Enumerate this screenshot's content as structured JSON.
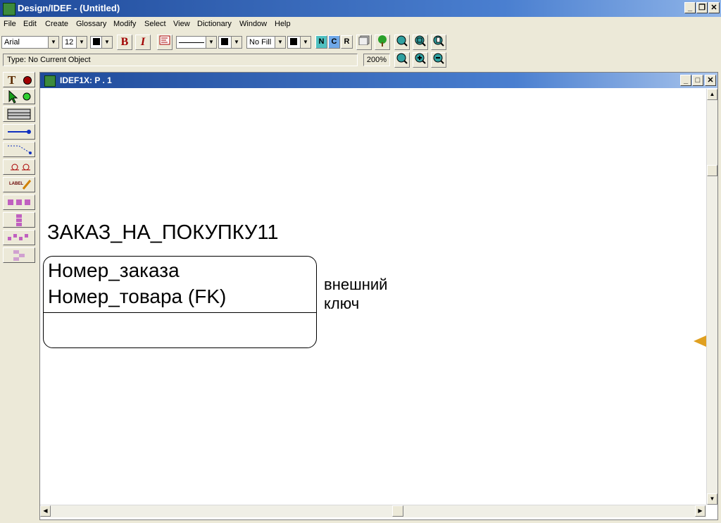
{
  "app": {
    "title": "Design/IDEF - (Untitled)"
  },
  "menu": [
    "File",
    "Edit",
    "Create",
    "Glossary",
    "Modify",
    "Select",
    "View",
    "Dictionary",
    "Window",
    "Help"
  ],
  "toolbar": {
    "font_name": "Arial",
    "font_size": "12",
    "fill": "No Fill",
    "bold_label": "B",
    "italic_label": "I",
    "n_label": "N",
    "c_label": "C",
    "r_label": "R"
  },
  "status": {
    "type_text": "Type: No Current Object",
    "zoom": "200%"
  },
  "palette": {
    "text_label": "T",
    "label_tool": "LABEL"
  },
  "child_window": {
    "title": "IDEF1X:   P . 1"
  },
  "diagram": {
    "entity_name": "ЗАКАЗ_НА_ПОКУПКУ11",
    "attributes": [
      "Номер_заказа",
      "Номер_товара (FK)"
    ],
    "note_lines": [
      "внешний",
      "ключ"
    ]
  }
}
